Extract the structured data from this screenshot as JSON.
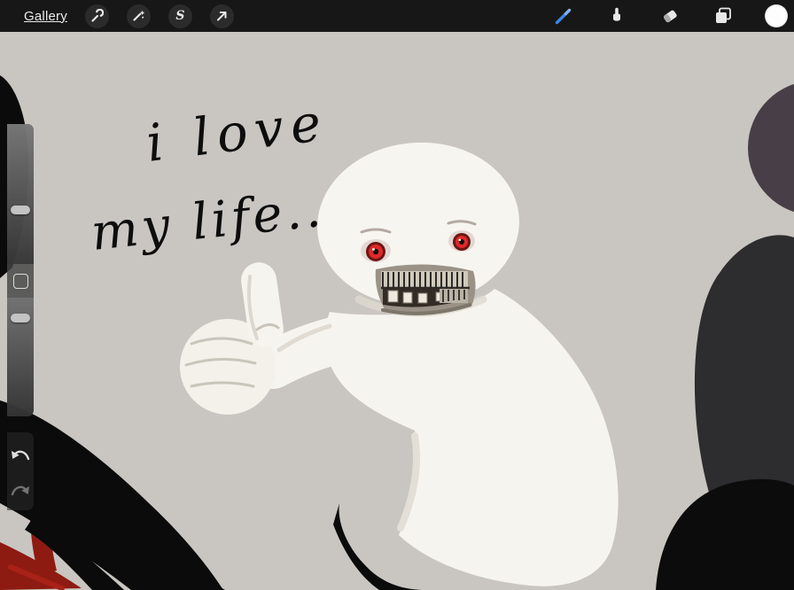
{
  "toolbar": {
    "gallery_label": "Gallery",
    "selection_glyph": "S",
    "bar_color": "#171717",
    "accent_color": "#3c86e8",
    "left_tools": [
      {
        "name": "actions",
        "icon": "wrench-icon"
      },
      {
        "name": "adjustments",
        "icon": "magic-wand-icon"
      },
      {
        "name": "selection",
        "icon": "selection-s-icon"
      },
      {
        "name": "transform",
        "icon": "arrow-cursor-icon"
      }
    ],
    "right_tools": [
      {
        "name": "paint",
        "icon": "paintbrush-icon",
        "active": true
      },
      {
        "name": "smudge",
        "icon": "smudge-finger-icon",
        "active": false
      },
      {
        "name": "erase",
        "icon": "eraser-icon",
        "active": false
      },
      {
        "name": "layers",
        "icon": "layers-icon",
        "active": false
      },
      {
        "name": "color",
        "icon": "color-swatch",
        "value": "#ffffff"
      }
    ]
  },
  "sidebar": {
    "sliders": [
      {
        "name": "brush-size"
      },
      {
        "name": "opacity"
      }
    ],
    "modify_icon": "square-icon",
    "undo_icon": "undo-arrow-icon",
    "redo_icon": "redo-arrow-icon"
  },
  "canvas": {
    "background_color": "#c9c6c1",
    "handwriting": {
      "line1": "i love",
      "line2": "my life.."
    },
    "colors": {
      "ink_black": "#0b0b0b",
      "ghost_white": "#f6f4ee",
      "eye_red": "#e02828",
      "blood_red": "#8e1b12",
      "blob_dark": "#2d2c2e",
      "blob_purple": "#473e47"
    }
  }
}
